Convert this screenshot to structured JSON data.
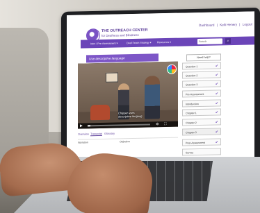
{
  "header": {
    "logo_title": "THE OUTREACH CENTER",
    "logo_subtitle": "for Deafness and Blindness",
    "account_links": [
      "Dashboard",
      "|",
      "Kelli Henery",
      "|",
      "Logout"
    ]
  },
  "nav": {
    "items": [
      "Intro / Pre-Assessment ▾",
      "Deaf-Teach Strategy ▾",
      "Resources ▾"
    ],
    "search_placeholder": "Search",
    "search_icon": "search-icon"
  },
  "video": {
    "banner_text": "Use descriptive language",
    "caption": "Chipper uses\ndescriptive languag",
    "progress": 0.04,
    "controls_icons": [
      "play-icon",
      "settings-icon",
      "fullscreen-icon"
    ]
  },
  "tabs": [
    "Overview",
    "Transcript",
    "Glossary"
  ],
  "tab_content": {
    "left": "Narration",
    "right": "Objective"
  },
  "sidebar": {
    "help_label": "Need help?",
    "items": [
      {
        "label": "Question 1",
        "done": true
      },
      {
        "label": "Question 2",
        "done": true
      },
      {
        "label": "Question 3",
        "done": true
      },
      {
        "label": "Pre-Assessment",
        "done": true
      },
      {
        "label": "Introduction",
        "done": true
      },
      {
        "label": "Chapter 1",
        "done": true
      },
      {
        "label": "Chapter 2",
        "done": true
      },
      {
        "label": "Chapter 3",
        "done": true
      },
      {
        "label": "Post-Assessment",
        "done": true
      },
      {
        "label": "Survey",
        "done": false
      }
    ],
    "check_glyph": "✔"
  },
  "colors": {
    "brand": "#6b45b8",
    "banner": "#7d56c7",
    "text_purple": "#5b3d99"
  }
}
